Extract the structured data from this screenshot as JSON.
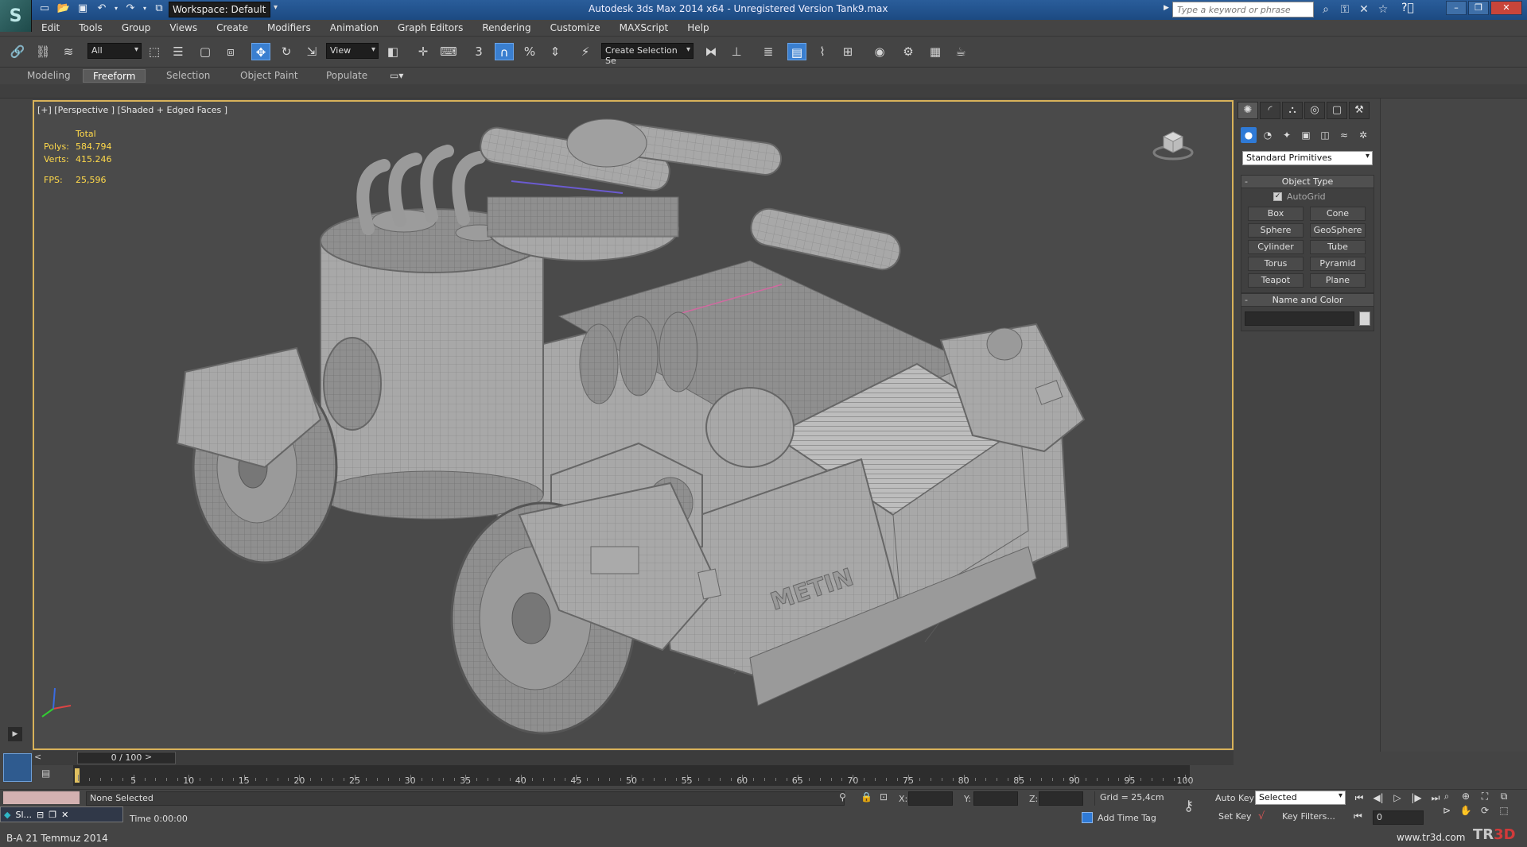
{
  "app": {
    "logo_letter": "S",
    "title": "Autodesk 3ds Max  2014 x64  -  Unregistered Version   Tank9.max",
    "workspace": "Workspace: Default",
    "search_placeholder": "Type a keyword or phrase"
  },
  "menu": [
    "Edit",
    "Tools",
    "Group",
    "Views",
    "Create",
    "Modifiers",
    "Animation",
    "Graph Editors",
    "Rendering",
    "Customize",
    "MAXScript",
    "Help"
  ],
  "toolbar": {
    "selection_filter": "All",
    "ref_coord": "View",
    "named_selection": "Create Selection Se"
  },
  "ribbon_tabs": [
    "Modeling",
    "Freeform",
    "Selection",
    "Object Paint",
    "Populate"
  ],
  "viewport": {
    "label": "[+] [Perspective ] [Shaded + Edged Faces ]",
    "stats": {
      "header": "Total",
      "polys_label": "Polys:",
      "polys": "584.794",
      "verts_label": "Verts:",
      "verts": "415.246",
      "fps_label": "FPS:",
      "fps": "25,596"
    },
    "model_text": "METIN"
  },
  "command_panel": {
    "category": "Standard Primitives",
    "object_type_title": "Object Type",
    "autogrid": "AutoGrid",
    "primitives": [
      "Box",
      "Cone",
      "Sphere",
      "GeoSphere",
      "Cylinder",
      "Tube",
      "Torus",
      "Pyramid",
      "Teapot",
      "Plane"
    ],
    "name_color_title": "Name and Color",
    "swatch_color": "#d7d7d7"
  },
  "timeline": {
    "frame_display": "0 / 100",
    "ticks": [
      5,
      10,
      15,
      20,
      25,
      30,
      35,
      40,
      45,
      50,
      55,
      60,
      65,
      70,
      75,
      80,
      85,
      90,
      95,
      100
    ]
  },
  "status": {
    "selection_text": "None Selected",
    "time_text": "Time  0:00:00",
    "x_label": "X:",
    "y_label": "Y:",
    "z_label": "Z:",
    "grid": "Grid = 25,4cm",
    "add_time_tag": "Add Time Tag",
    "auto_key": "Auto Key",
    "set_key": "Set Key",
    "selected": "Selected",
    "key_filters": "Key Filters...",
    "current_frame": "0",
    "taskbar_label": "Sl...",
    "bottom_left": "B-A 21 Temmuz 2014",
    "watermark": "www.tr3d.com",
    "logo_tr": "TR",
    "logo_3d": "3D"
  },
  "colors": {
    "viewport_border": "#d8b25a",
    "stats_text": "#ffd94a",
    "title_bar": "#2a5d9a",
    "active_tool": "#3a7fd0"
  }
}
